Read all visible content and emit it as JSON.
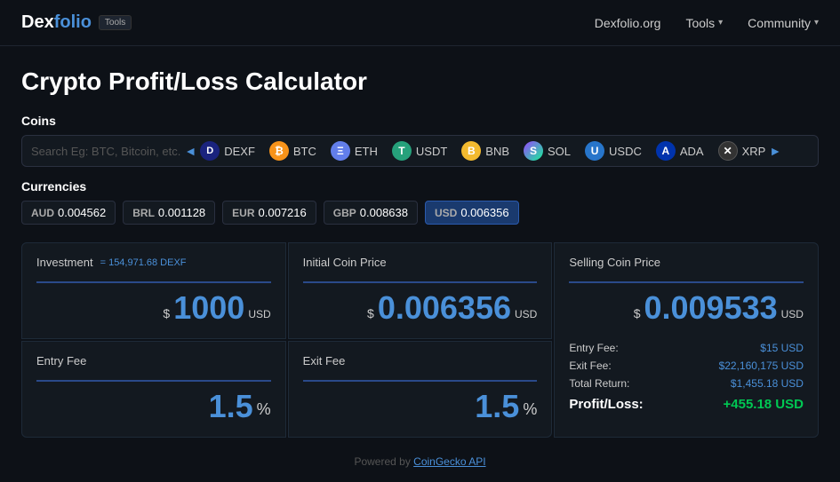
{
  "header": {
    "logo_dex": "Dex",
    "logo_folio": "folio",
    "tools_badge": "Tools",
    "nav": {
      "site_link": "Dexfolio.org",
      "tools_label": "Tools",
      "community_label": "Community"
    }
  },
  "page": {
    "title": "Crypto Profit/Loss Calculator"
  },
  "coins": {
    "section_label": "Coins",
    "search_placeholder": "Search Eg: BTC, Bitcoin, etc.",
    "items": [
      {
        "id": "dexf",
        "symbol": "DEXF",
        "icon_letter": "D",
        "icon_color": "#1a237e"
      },
      {
        "id": "btc",
        "symbol": "BTC",
        "icon_letter": "₿",
        "icon_color": "#f7931a"
      },
      {
        "id": "eth",
        "symbol": "ETH",
        "icon_letter": "Ξ",
        "icon_color": "#627eea"
      },
      {
        "id": "usdt",
        "symbol": "USDT",
        "icon_letter": "T",
        "icon_color": "#26a17b"
      },
      {
        "id": "bnb",
        "symbol": "BNB",
        "icon_letter": "B",
        "icon_color": "#f3ba2f"
      },
      {
        "id": "sol",
        "symbol": "SOL",
        "icon_letter": "S",
        "icon_color": "#9945ff"
      },
      {
        "id": "usdc",
        "symbol": "USDC",
        "icon_letter": "U",
        "icon_color": "#2775ca"
      },
      {
        "id": "ada",
        "symbol": "ADA",
        "icon_letter": "A",
        "icon_color": "#0033ad"
      },
      {
        "id": "xrp",
        "symbol": "XRP",
        "icon_letter": "✕",
        "icon_color": "#333333"
      }
    ]
  },
  "currencies": {
    "section_label": "Currencies",
    "items": [
      {
        "code": "AUD",
        "value": "0.004562",
        "active": false
      },
      {
        "code": "BRL",
        "value": "0.001128",
        "active": false
      },
      {
        "code": "EUR",
        "value": "0.007216",
        "active": false
      },
      {
        "code": "GBP",
        "value": "0.008638",
        "active": false
      },
      {
        "code": "USD",
        "value": "0.006356",
        "active": true
      }
    ]
  },
  "calculator": {
    "investment": {
      "title": "Investment",
      "subtitle": "= 154,971.68 DEXF",
      "currency_symbol": "$",
      "value": "1000",
      "unit": "USD"
    },
    "initial_price": {
      "title": "Initial Coin Price",
      "currency_symbol": "$",
      "value": "0.006356",
      "unit": "USD"
    },
    "selling_price": {
      "title": "Selling Coin Price",
      "currency_symbol": "$",
      "value": "0.009533",
      "unit": "USD"
    },
    "entry_fee": {
      "title": "Entry Fee",
      "value": "1.5",
      "unit": "%"
    },
    "exit_fee": {
      "title": "Exit Fee",
      "value": "1.5",
      "unit": "%"
    },
    "summary": {
      "entry_fee_label": "Entry Fee:",
      "entry_fee_value": "$15 USD",
      "exit_fee_label": "Exit Fee:",
      "exit_fee_value": "$22,160,175 USD",
      "total_return_label": "Total Return:",
      "total_return_value": "$1,455.18 USD",
      "profit_loss_label": "Profit/Loss:",
      "profit_loss_value": "+455.18 USD"
    }
  },
  "footer": {
    "text": "Powered by ",
    "link_text": "CoinGecko API"
  }
}
